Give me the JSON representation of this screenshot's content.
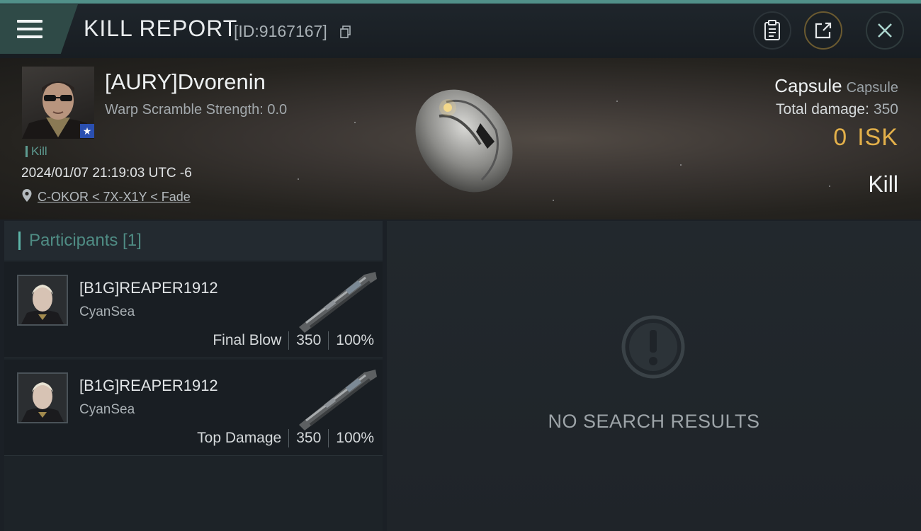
{
  "header": {
    "title": "KILL REPORT",
    "report_id": "[ID:9167167]"
  },
  "victim": {
    "name": "[AURY]Dvorenin",
    "warp_scramble": "Warp Scramble Strength: 0.0",
    "tag": "Kill",
    "datetime": "2024/01/07 21:19:03 UTC -6",
    "location": "C-OKOR < 7X-X1Y < Fade"
  },
  "ship_info": {
    "name": "Capsule",
    "class": "Capsule",
    "total_damage_label": "Total damage:",
    "total_damage_value": "350",
    "isk_value": "0",
    "isk_unit": "ISK",
    "result": "Kill"
  },
  "participants": {
    "header": "Participants [1]",
    "rows": [
      {
        "name": "[B1G]REAPER1912",
        "corp": "CyanSea",
        "role": "Final Blow",
        "damage": "350",
        "percent": "100%"
      },
      {
        "name": "[B1G]REAPER1912",
        "corp": "CyanSea",
        "role": "Top Damage",
        "damage": "350",
        "percent": "100%"
      }
    ]
  },
  "results": {
    "empty_text": "NO SEARCH RESULTS"
  },
  "colors": {
    "accent_teal": "#5eb6aa",
    "isk_gold": "#e3b04a"
  },
  "icons": [
    "menu-icon",
    "copy-icon",
    "clipboard-icon",
    "share-icon",
    "close-icon",
    "location-pin-icon",
    "star-icon",
    "exclamation-icon"
  ]
}
